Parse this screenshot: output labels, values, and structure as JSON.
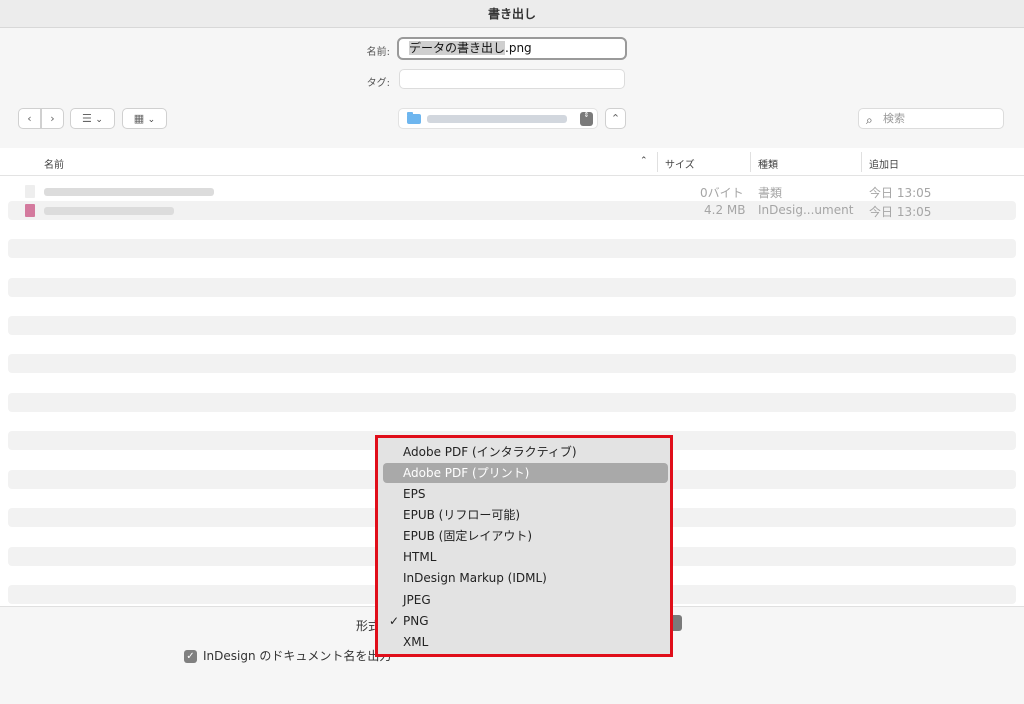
{
  "window": {
    "title": "書き出し"
  },
  "form": {
    "name_label": "名前:",
    "name_selected": "データの書き出し",
    "name_ext": ".png",
    "tag_label": "タグ:"
  },
  "toolbar": {
    "back_glyph": "‹",
    "forward_glyph": "›",
    "list_view_glyph": "☰",
    "icon_view_glyph": "▦",
    "chevron": "⌄",
    "path_arrows": "⇕",
    "up_glyph": "⌃",
    "search_glyph": "⌕",
    "search_placeholder": "検索"
  },
  "columns": {
    "name": "名前",
    "sort_glyph": "⌃",
    "size": "サイズ",
    "kind": "種類",
    "date_added": "追加日"
  },
  "files": [
    {
      "size": "0バイト",
      "kind": "書類",
      "date": "今日 13:05"
    },
    {
      "size": "4.2 MB",
      "kind": "InDesig...ument",
      "date": "今日 13:05"
    }
  ],
  "bottom": {
    "format_label": "形式",
    "checkbox_mark": "✓",
    "checkbox_text": "InDesign のドキュメント名を出力"
  },
  "format_menu": {
    "items": [
      "Adobe PDF (インタラクティブ)",
      "Adobe PDF (プリント)",
      "EPS",
      "EPUB (リフロー可能)",
      "EPUB (固定レイアウト)",
      "HTML",
      "InDesign Markup (IDML)",
      "JPEG",
      "PNG",
      "XML"
    ],
    "highlighted": "Adobe PDF (プリント)",
    "checked": "PNG",
    "check_glyph": "✓"
  },
  "colors": {
    "annotation_border": "#e00e1a",
    "folder": "#6eb6ef",
    "menu_highlight": "#a9a9a9"
  }
}
